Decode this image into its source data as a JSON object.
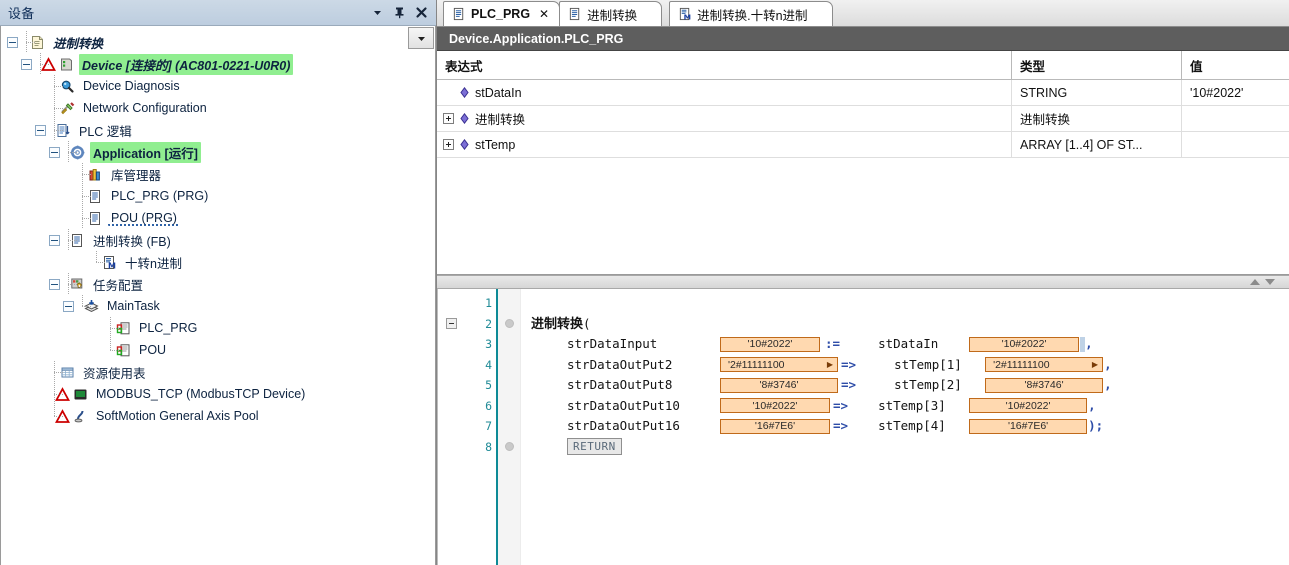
{
  "left_panel": {
    "title": "设备",
    "buttons": {
      "dropdown": "dropdown-arrow",
      "pin": "pin",
      "close": "close"
    },
    "tree_dropdown_label": "▾",
    "tree": [
      {
        "label": "进制转换",
        "icon": "project-icon",
        "depth": 0,
        "expander": "minus",
        "style": "italic-bold"
      },
      {
        "label": "Device [连接的] (AC801-0221-U0R0)",
        "icon": "device-icon",
        "depth": 1,
        "expander": "minus",
        "style": "italic-bold-highlight",
        "warning": true
      },
      {
        "label": "Device Diagnosis",
        "icon": "diagnosis-icon",
        "depth": 2,
        "expander": "none",
        "style": "plain"
      },
      {
        "label": "Network Configuration",
        "icon": "network-icon",
        "depth": 2,
        "expander": "none",
        "style": "plain"
      },
      {
        "label": "PLC 逻辑",
        "icon": "plc-logic-icon",
        "depth": 2,
        "expander": "minus",
        "style": "plain"
      },
      {
        "label": "Application [运行]",
        "icon": "application-icon",
        "depth": 3,
        "expander": "minus",
        "style": "bold-highlight"
      },
      {
        "label": "库管理器",
        "icon": "library-icon",
        "depth": 4,
        "expander": "none",
        "style": "plain"
      },
      {
        "label": "PLC_PRG (PRG)",
        "icon": "pou-icon",
        "depth": 4,
        "expander": "none",
        "style": "plain"
      },
      {
        "label": "POU (PRG)",
        "icon": "pou-icon",
        "depth": 4,
        "expander": "none",
        "style": "squiggle"
      },
      {
        "label": "进制转换 (FB)",
        "icon": "pou-icon",
        "depth": 4,
        "expander": "minus",
        "style": "plain"
      },
      {
        "label": "十转n进制",
        "icon": "method-icon",
        "depth": 5,
        "expander": "none",
        "style": "plain"
      },
      {
        "label": "任务配置",
        "icon": "task-config-icon",
        "depth": 3,
        "expander": "minus",
        "style": "plain"
      },
      {
        "label": "MainTask",
        "icon": "task-icon",
        "depth": 4,
        "expander": "minus",
        "style": "plain"
      },
      {
        "label": "PLC_PRG",
        "icon": "task-call-icon",
        "depth": 5,
        "expander": "none",
        "style": "plain"
      },
      {
        "label": "POU",
        "icon": "task-call-icon",
        "depth": 5,
        "expander": "none",
        "style": "plain"
      },
      {
        "label": "资源使用表",
        "icon": "resource-table-icon",
        "depth": 2,
        "expander": "none",
        "style": "plain"
      },
      {
        "label": "MODBUS_TCP (ModbusTCP Device)",
        "icon": "modbus-device-icon",
        "depth": 2,
        "expander": "none",
        "style": "plain",
        "warning": true
      },
      {
        "label": "SoftMotion General Axis Pool",
        "icon": "axis-pool-icon",
        "depth": 2,
        "expander": "none",
        "style": "plain",
        "warning": true
      }
    ]
  },
  "editor": {
    "tabs": [
      {
        "label": "PLC_PRG",
        "icon": "pou-icon",
        "active": true,
        "closable": true,
        "close_glyph": "✕"
      },
      {
        "label": "进制转换",
        "icon": "pou-icon",
        "active": false,
        "closable": false
      },
      {
        "label": "进制转换.十转n进制",
        "icon": "method-icon",
        "active": false,
        "closable": false
      }
    ],
    "path_bar": "Device.Application.PLC_PRG",
    "declaration_grid": {
      "columns": [
        "表达式",
        "类型",
        "值"
      ],
      "rows": [
        {
          "expandable": false,
          "expression": "stDataIn",
          "type": "STRING",
          "value": "'10#2022'"
        },
        {
          "expandable": true,
          "expression": "进制转换",
          "type": "进制转换",
          "value": ""
        },
        {
          "expandable": true,
          "expression": "stTemp",
          "type": "ARRAY [1..4] OF ST...",
          "value": ""
        }
      ]
    },
    "splitter": {
      "up_glyph": "▲",
      "down_glyph": "▼"
    },
    "code": {
      "lines": [
        {
          "number": "1",
          "fold": "",
          "marker": false,
          "content": ""
        },
        {
          "number": "2",
          "fold": "minus",
          "marker": true,
          "content": "进制转换("
        },
        {
          "number": "3",
          "fold": "",
          "marker": false,
          "content": "strDataInput := stDataIn ,"
        },
        {
          "number": "4",
          "fold": "",
          "marker": false,
          "content": "strDataOutPut2 => stTemp[1] ,"
        },
        {
          "number": "5",
          "fold": "",
          "marker": false,
          "content": "strDataOutPut8 => stTemp[2] ,"
        },
        {
          "number": "6",
          "fold": "",
          "marker": false,
          "content": "strDataOutPut10 => stTemp[3] ,"
        },
        {
          "number": "7",
          "fold": "",
          "marker": false,
          "content": "strDataOutPut16 => stTemp[4] );"
        },
        {
          "number": "8",
          "fold": "",
          "marker": true,
          "content": "RETURN"
        }
      ],
      "call_name": "进制转换",
      "open_paren": "(",
      "return_label": "RETURN",
      "params": [
        {
          "name": "strDataInput",
          "in_value": "'10#2022'",
          "in_truncated": false,
          "op": ":=",
          "target": "stDataIn",
          "out_value": "'10#2022'",
          "out_truncated": false,
          "tail": ","
        },
        {
          "name": "strDataOutPut2",
          "in_value": "'2#11111100",
          "in_truncated": true,
          "op": "=>",
          "target": "stTemp[1]",
          "out_value": "'2#11111100",
          "out_truncated": true,
          "tail": ","
        },
        {
          "name": "strDataOutPut8",
          "in_value": "'8#3746'",
          "in_truncated": false,
          "op": "=>",
          "target": "stTemp[2]",
          "out_value": "'8#3746'",
          "out_truncated": false,
          "tail": ","
        },
        {
          "name": "strDataOutPut10",
          "in_value": "'10#2022'",
          "in_truncated": false,
          "op": "=>",
          "target": "stTemp[3]",
          "out_value": "'10#2022'",
          "out_truncated": false,
          "tail": ","
        },
        {
          "name": "strDataOutPut16",
          "in_value": "'16#7E6'",
          "in_truncated": false,
          "op": "=>",
          "target": "stTemp[4]",
          "out_value": "'16#7E6'",
          "out_truncated": false,
          "tail": ");"
        }
      ],
      "truncation_glyph": "▶"
    }
  },
  "colors": {
    "highlight_green": "#90ee90",
    "value_box_bg": "#ffd9b0",
    "value_box_border": "#c06a1a",
    "path_bar_bg": "#5e5e5e",
    "line_number": "#1f8a96",
    "panel_header": "#c5d3e2"
  }
}
